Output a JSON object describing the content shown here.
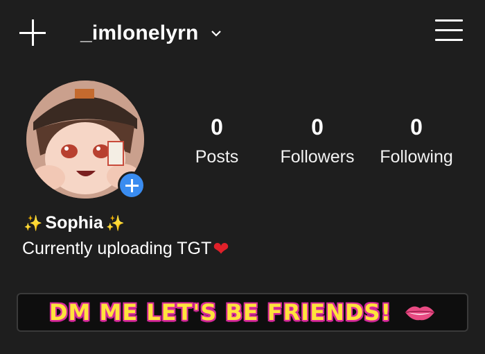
{
  "header": {
    "username": "_imlonelyrn"
  },
  "profile": {
    "display_name": "Sophia",
    "bio": "Currently uploading TGT",
    "stats": [
      {
        "value": "0",
        "label": "Posts"
      },
      {
        "value": "0",
        "label": "Followers"
      },
      {
        "value": "0",
        "label": "Following"
      }
    ]
  },
  "banner": {
    "text": "DM ME LET'S BE FRIENDS!"
  },
  "icons": {
    "top_left": "plus-icon",
    "top_right": "hamburger-menu-icon",
    "username_dropdown": "chevron-down-icon",
    "avatar_badge": "add-story-icon",
    "name_decoration": "sparkles-icon",
    "bio_decoration": "heart-icon",
    "banner_decoration": "lips-icon"
  },
  "colors": {
    "background": "#1e1e1e",
    "text": "#ffffff",
    "badge_blue": "#3a8cf0",
    "banner_yellow": "#ffe33c",
    "banner_pink": "#d62a9a",
    "heart_red": "#e0212a"
  }
}
